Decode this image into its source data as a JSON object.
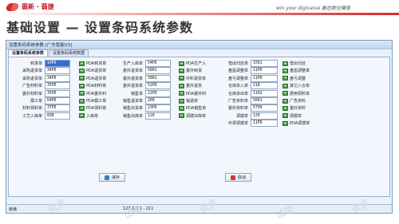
{
  "slide": {
    "logo_text": "翡新 · 翡捷",
    "slogan": "win your digivalue 赢在数位價值",
    "title": "基础设置 — 设置条码系统参数",
    "watermark": "试读",
    "accent": "#d42a2a"
  },
  "window": {
    "title": "设置条码系统参数 [广东智能V3]",
    "tabs": [
      "设置条码系统参数",
      "设置条码系统数据"
    ],
    "active_tab": 0,
    "save_label": "保存",
    "cancel_label": "取消",
    "status_left": "就绪",
    "status_mid": "127.0.0.1 - 211"
  },
  "columns": [
    [
      {
        "label": "到货单",
        "value": "14PD",
        "selected": true,
        "check": "PDA到货单"
      },
      {
        "label": "采购退货单",
        "value": "34PD",
        "check": "PDA退货单"
      },
      {
        "label": "采购退货单",
        "value": "34PD",
        "check": "PDA退货单"
      },
      {
        "label": "广告材料单",
        "value": "35PD",
        "check": "PDA材料单"
      },
      {
        "label": "委外材料单",
        "value": "35PD",
        "check": "PDA委外料"
      },
      {
        "label": "报工单",
        "value": "64PD",
        "check": "PDA报工单"
      },
      {
        "label": "材料领料单",
        "value": "37PD",
        "check": "PDA领料单"
      },
      {
        "label": "工艺入库单",
        "value": "838",
        "check": "入库单"
      }
    ],
    [
      {
        "label": "生产入库单",
        "value": "54PD",
        "check": "PDA生产入"
      },
      {
        "label": "委外退货单",
        "value": "5801",
        "check": "委外到货"
      },
      {
        "label": "委外退货单",
        "value": "5801",
        "check": "补料退货单"
      },
      {
        "label": "委外退货单",
        "value": "51PD",
        "check": "委外退货"
      },
      {
        "label": "销售单",
        "value": "21PD",
        "check": "PDA委外料"
      },
      {
        "label": "销售退货单",
        "value": "260",
        "check": "销退单"
      },
      {
        "label": "销售出货单",
        "value": "23PD",
        "check": "PDA销售单"
      },
      {
        "label": "销售出库单",
        "value": "120",
        "check": "调拨出库单"
      }
    ],
    [
      {
        "label": "借出归还单",
        "value": "1501",
        "check": "借出归还"
      },
      {
        "label": "盘盈调整单",
        "value": "11PD",
        "check": "盘盈调整单"
      },
      {
        "label": "盘亏调整单",
        "value": "11PD",
        "check": "盘亏调整"
      },
      {
        "label": "仓库杂入单",
        "value": "218",
        "check": "其它入仓单"
      },
      {
        "label": "仓库杂出单",
        "value": "1102",
        "check": "费用领料单"
      },
      {
        "label": "广告资料单",
        "value": "5601",
        "check": "广告资料"
      },
      {
        "label": "委外资料单",
        "value": "5709",
        "check": "委外资料"
      },
      {
        "label": "调拨单",
        "value": "120",
        "check": "调拨单"
      },
      {
        "label": "补领调拨单",
        "value": "11PD",
        "check": "PDA调拨单"
      }
    ]
  ]
}
